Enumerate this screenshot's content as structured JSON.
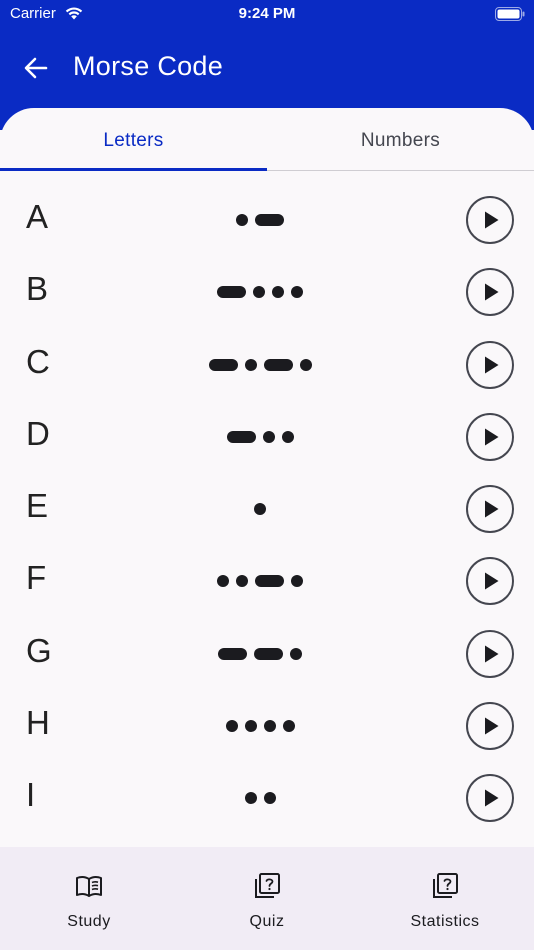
{
  "status_bar": {
    "carrier": "Carrier",
    "time": "9:24 PM",
    "icons": [
      "wifi-icon",
      "battery-icon"
    ]
  },
  "header": {
    "title": "Morse Code",
    "back_icon": "arrow-left-icon",
    "background": "#0a2bc4"
  },
  "tabs": [
    {
      "label": "Letters",
      "selected": true
    },
    {
      "label": "Numbers",
      "selected": false
    }
  ],
  "letters": [
    {
      "letter": "A",
      "code": ".-"
    },
    {
      "letter": "B",
      "code": "-..."
    },
    {
      "letter": "C",
      "code": "-.-."
    },
    {
      "letter": "D",
      "code": "-.."
    },
    {
      "letter": "E",
      "code": "."
    },
    {
      "letter": "F",
      "code": "..-."
    },
    {
      "letter": "G",
      "code": "--."
    },
    {
      "letter": "H",
      "code": "...."
    },
    {
      "letter": "I",
      "code": ".."
    }
  ],
  "row_action_icon": "play-circle-icon",
  "bottom_nav": [
    {
      "label": "Study",
      "icon": "open-book-icon"
    },
    {
      "label": "Quiz",
      "icon": "quiz-cards-icon"
    },
    {
      "label": "Statistics",
      "icon": "quiz-cards-icon"
    }
  ],
  "colors": {
    "accent": "#0a2bc4",
    "background": "#faf8fa",
    "bottom_nav_background": "#f1ecf5",
    "text": "#1b1b1f"
  }
}
